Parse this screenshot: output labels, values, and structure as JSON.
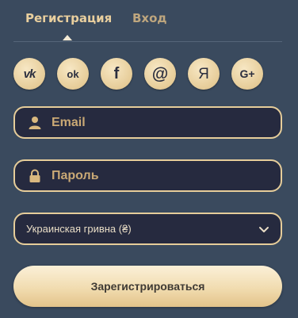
{
  "tabs": [
    {
      "label": "Регистрация",
      "active": true
    },
    {
      "label": "Вход",
      "active": false
    }
  ],
  "socials": [
    {
      "name": "vk",
      "glyph": "vk"
    },
    {
      "name": "odnoklassniki",
      "glyph": "ok"
    },
    {
      "name": "facebook",
      "glyph": "f"
    },
    {
      "name": "mail",
      "glyph": "@"
    },
    {
      "name": "yandex",
      "glyph": "Я"
    },
    {
      "name": "google-plus",
      "glyph": "G+"
    }
  ],
  "email": {
    "placeholder": "Email",
    "icon": "user-icon"
  },
  "password": {
    "placeholder": "Пароль",
    "icon": "lock-icon"
  },
  "currency": {
    "selected": "Украинская гривна (₴)"
  },
  "submit": {
    "label": "Зарегистрироваться"
  },
  "colors": {
    "accent": "#e6cd9a",
    "background": "#3a4a5e",
    "field_bg": "#262a3f"
  }
}
